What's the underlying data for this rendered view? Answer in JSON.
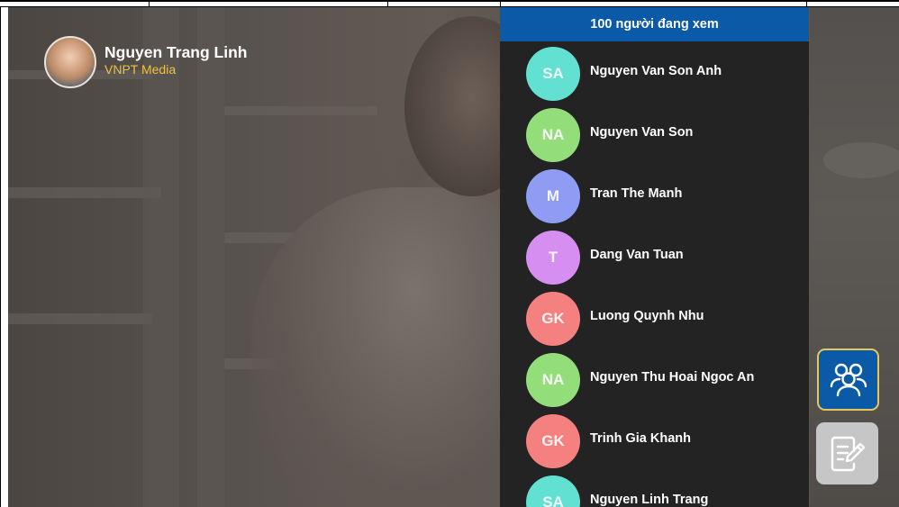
{
  "presenter": {
    "name": "Nguyen Trang Linh",
    "organization": "VNPT Media"
  },
  "viewers_panel": {
    "header": "100 người đang xem",
    "header_color": "#0a5aa8",
    "items": [
      {
        "initials": "SA",
        "name": "Nguyen Van Son Anh",
        "color": "#62e0d2"
      },
      {
        "initials": "NA",
        "name": "Nguyen Van Son",
        "color": "#93de7a"
      },
      {
        "initials": "M",
        "name": "Tran The Manh",
        "color": "#8f9cf4"
      },
      {
        "initials": "T",
        "name": "Dang Van Tuan",
        "color": "#d78ef1"
      },
      {
        "initials": "GK",
        "name": "Luong Quynh Nhu",
        "color": "#f48080"
      },
      {
        "initials": "NA",
        "name": "Nguyen Thu Hoai Ngoc An",
        "color": "#93de7a"
      },
      {
        "initials": "GK",
        "name": "Trinh Gia Khanh",
        "color": "#f48080"
      },
      {
        "initials": "SA",
        "name": "Nguyen Linh Trang",
        "color": "#62e0d2"
      }
    ]
  },
  "side_buttons": {
    "viewers": {
      "icon": "users-icon",
      "accent": "#e8c75a"
    },
    "notes": {
      "icon": "edit-note-icon"
    }
  }
}
